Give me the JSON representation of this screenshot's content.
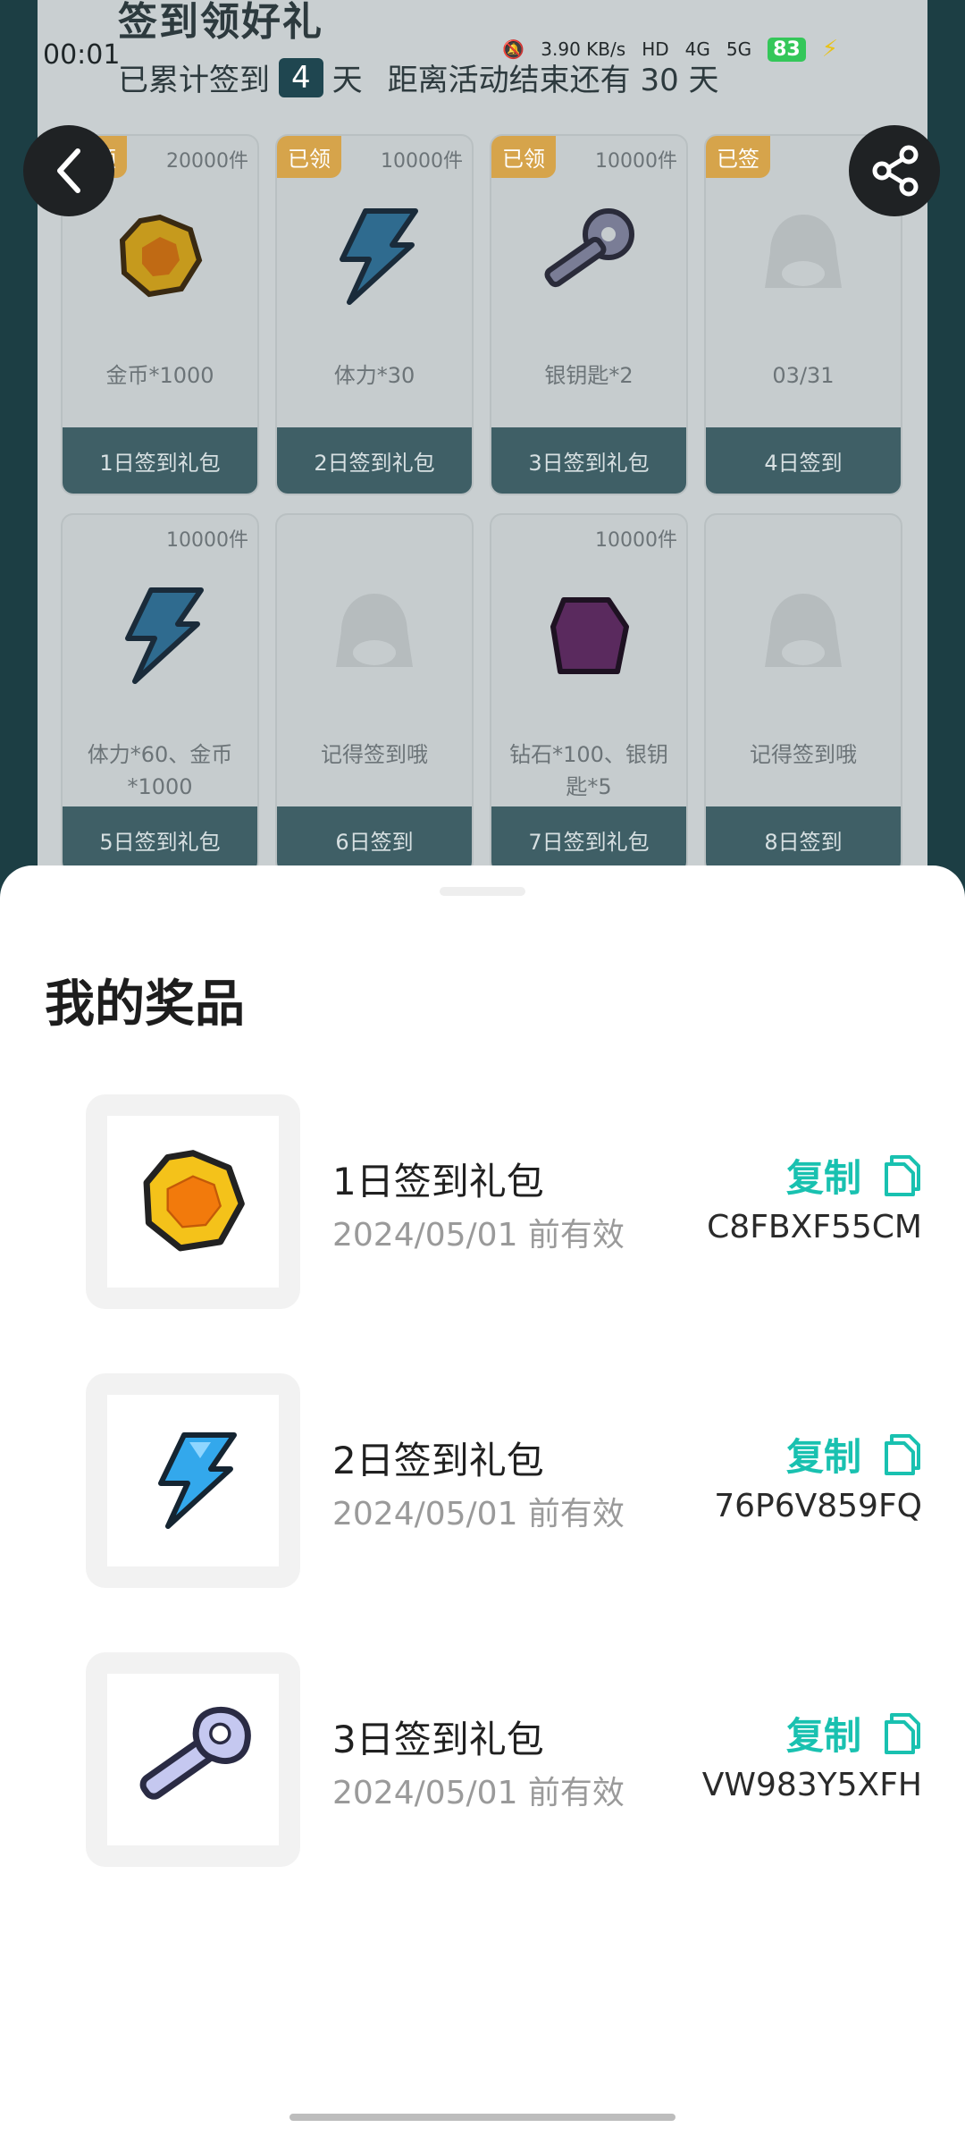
{
  "background": {
    "title": "签到领好礼",
    "summary": {
      "prefix": "已累计签到",
      "days": "4",
      "suffix": "天",
      "remaining": "距离活动结束还有 30 天"
    },
    "cards": [
      {
        "tag": "已领",
        "qty": "20000件",
        "icon": "coin-icon",
        "desc": "金币*1000",
        "footer": "1日签到礼包"
      },
      {
        "tag": "已领",
        "qty": "10000件",
        "icon": "lightning-icon",
        "desc": "体力*30",
        "footer": "2日签到礼包"
      },
      {
        "tag": "已领",
        "qty": "10000件",
        "icon": "key-icon",
        "desc": "银钥匙*2",
        "footer": "3日签到礼包"
      },
      {
        "tag": "已签",
        "qty": "",
        "icon": "mascot-placeholder-icon",
        "desc": "03/31",
        "footer": "4日签到"
      },
      {
        "tag": "",
        "qty": "10000件",
        "icon": "lightning-icon",
        "desc": "体力*60、金币*1000",
        "footer": "5日签到礼包"
      },
      {
        "tag": "",
        "qty": "",
        "icon": "mascot-placeholder-icon",
        "desc": "记得签到哦",
        "footer": "6日签到"
      },
      {
        "tag": "",
        "qty": "10000件",
        "icon": "gem-icon",
        "desc": "钻石*100、银钥匙*5",
        "footer": "7日签到礼包"
      },
      {
        "tag": "",
        "qty": "",
        "icon": "mascot-placeholder-icon",
        "desc": "记得签到哦",
        "footer": "8日签到"
      }
    ]
  },
  "status_bar": {
    "time": "00:01",
    "speed": "3.90 KB/s",
    "network": [
      "HD",
      "4G",
      "5G"
    ],
    "battery": "83"
  },
  "sheet": {
    "title": "我的奖品",
    "prizes": [
      {
        "name": "1日签到礼包",
        "expiry": "2024/05/01 前有效",
        "copy_label": "复制",
        "code": "C8FBXF55CM",
        "icon": "coin-icon"
      },
      {
        "name": "2日签到礼包",
        "expiry": "2024/05/01 前有效",
        "copy_label": "复制",
        "code": "76P6V859FQ",
        "icon": "lightning-icon"
      },
      {
        "name": "3日签到礼包",
        "expiry": "2024/05/01 前有效",
        "copy_label": "复制",
        "code": "VW983Y5XFH",
        "icon": "key-icon"
      }
    ]
  },
  "colors": {
    "accent": "#19c1b0",
    "tag": "#d6a44b",
    "card_footer": "#3f5f66"
  }
}
